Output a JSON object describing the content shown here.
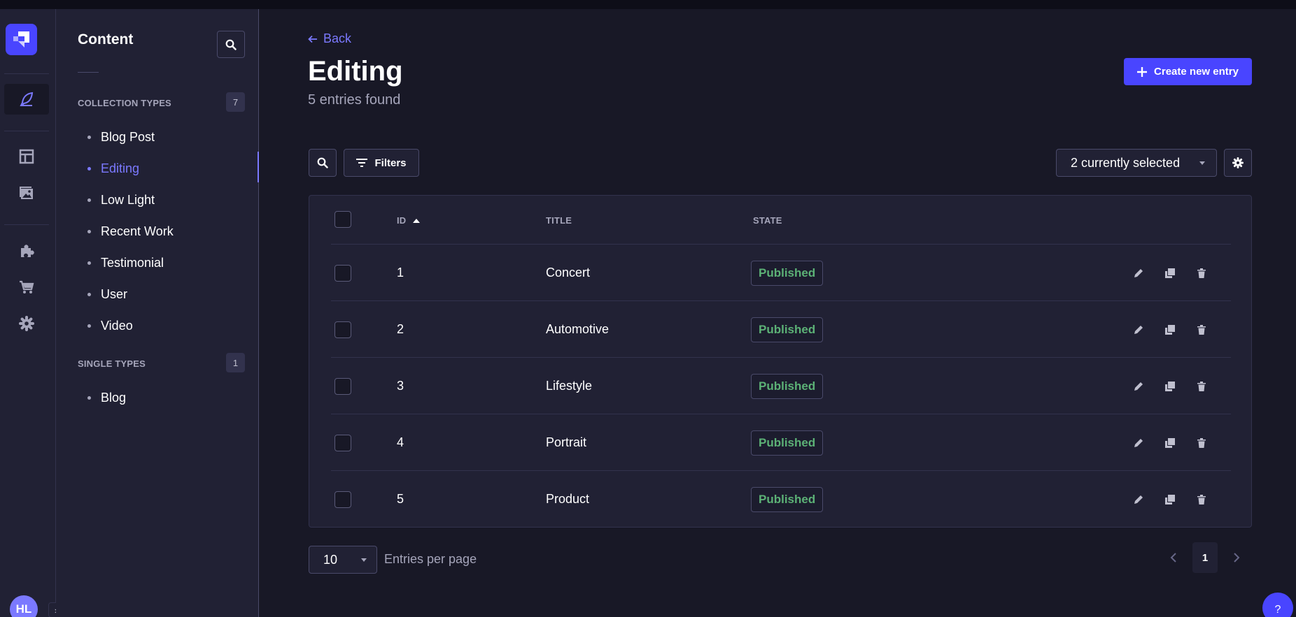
{
  "sidebar": {
    "title": "Content",
    "collection_types": {
      "label": "COLLECTION TYPES",
      "count": "7",
      "items": [
        {
          "label": "Blog Post"
        },
        {
          "label": "Editing"
        },
        {
          "label": "Low Light"
        },
        {
          "label": "Recent Work"
        },
        {
          "label": "Testimonial"
        },
        {
          "label": "User"
        },
        {
          "label": "Video"
        }
      ]
    },
    "single_types": {
      "label": "SINGLE TYPES",
      "count": "1",
      "items": [
        {
          "label": "Blog"
        }
      ]
    },
    "active_item": "Editing"
  },
  "user": {
    "initials": "HL"
  },
  "header": {
    "back_label": "Back",
    "title": "Editing",
    "subtitle": "5 entries found",
    "create_label": "Create new entry"
  },
  "toolbar": {
    "filters_label": "Filters",
    "columns_selected": "2 currently selected"
  },
  "table": {
    "columns": [
      "ID",
      "TITLE",
      "STATE"
    ],
    "sorted_column": "ID",
    "sort_direction": "ascending",
    "rows": [
      {
        "id": "1",
        "title": "Concert",
        "state": "Published"
      },
      {
        "id": "2",
        "title": "Automotive",
        "state": "Published"
      },
      {
        "id": "3",
        "title": "Lifestyle",
        "state": "Published"
      },
      {
        "id": "4",
        "title": "Portrait",
        "state": "Published"
      },
      {
        "id": "5",
        "title": "Product",
        "state": "Published"
      }
    ]
  },
  "pagination": {
    "page_size": "10",
    "page_size_label": "Entries per page",
    "current_page": "1"
  },
  "help": {
    "label": "?"
  },
  "colors": {
    "accent": "#4945ff",
    "accent_text": "#7b79ff",
    "published": "#5cb176",
    "background": "#181826",
    "panel": "#212134"
  }
}
